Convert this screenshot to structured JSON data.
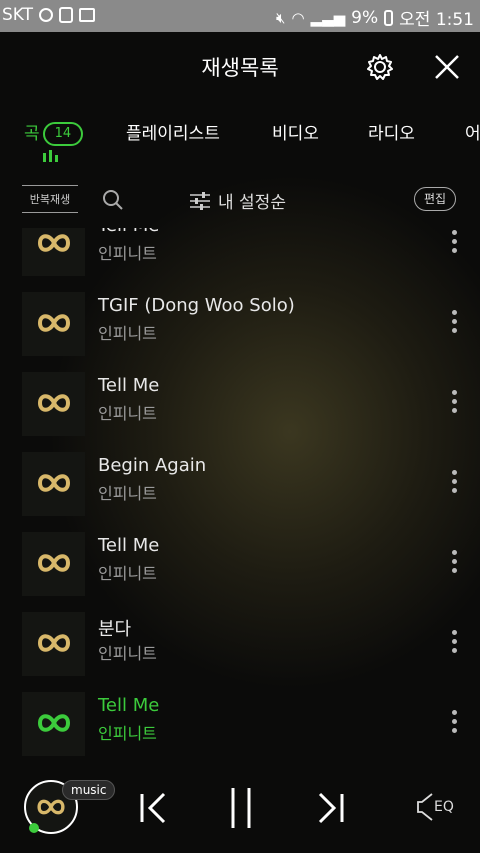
{
  "status": {
    "carrier": "SKT",
    "battery": "9%",
    "time": "오전 1:51"
  },
  "header": {
    "title": "재생목록"
  },
  "tabs": [
    {
      "label": "곡",
      "count": "14",
      "active": true
    },
    {
      "label": "플레이리스트"
    },
    {
      "label": "비디오"
    },
    {
      "label": "라디오"
    },
    {
      "label": "어"
    }
  ],
  "toolbar": {
    "repeat_label": "반복재생",
    "sort_label": "내 설정순",
    "edit_label": "편집"
  },
  "songs": [
    {
      "title": "Tell Me",
      "artist": "인피니트"
    },
    {
      "title": "TGIF (Dong Woo Solo)",
      "artist": "인피니트"
    },
    {
      "title": "Tell Me",
      "artist": "인피니트"
    },
    {
      "title": "Begin Again",
      "artist": "인피니트"
    },
    {
      "title": "Tell Me",
      "artist": "인피니트"
    },
    {
      "title": "분다",
      "artist": "인피니트"
    },
    {
      "title": "Tell Me",
      "artist": "인피니트",
      "current": true
    }
  ],
  "player": {
    "badge": "music",
    "eq_label": "EQ"
  },
  "colors": {
    "accent": "#3ccb3c",
    "logo_gold": "#d8b86a"
  }
}
